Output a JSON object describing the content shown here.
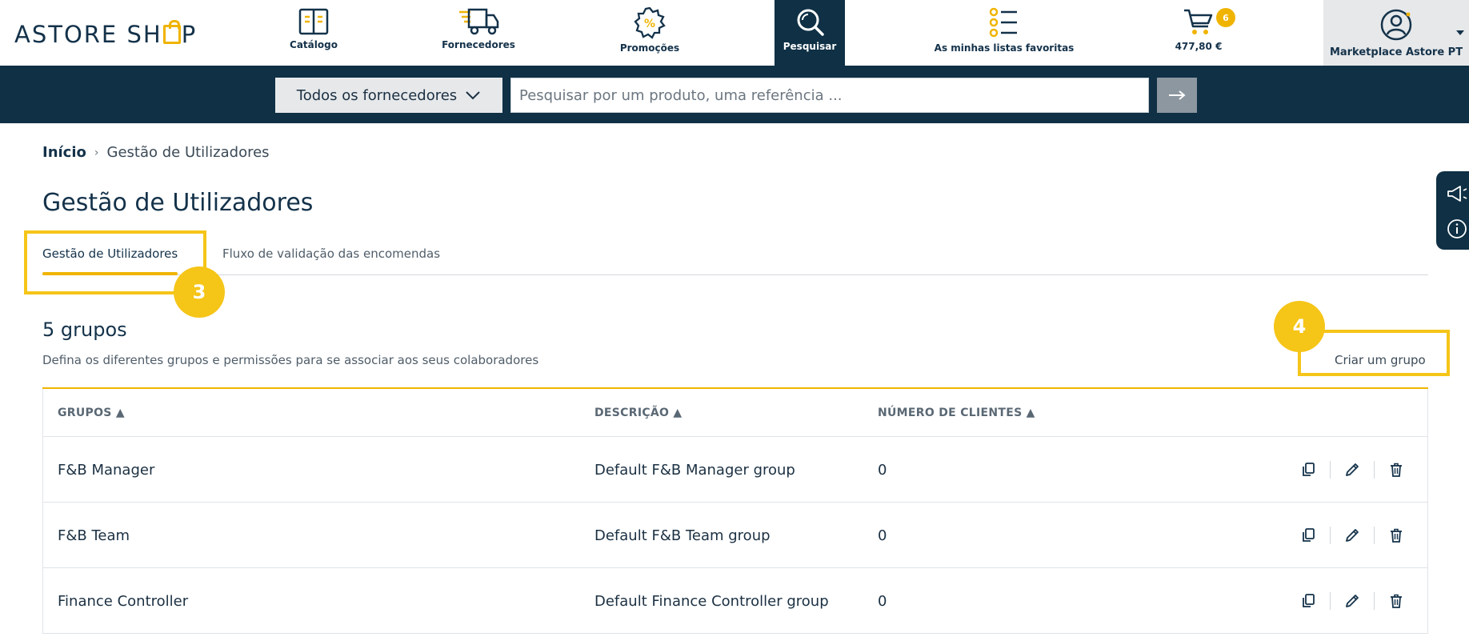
{
  "header": {
    "logo_text_a": "ASTORE SH",
    "logo_text_b": "P",
    "nav": [
      {
        "label": "Catálogo",
        "icon": "catalog-icon"
      },
      {
        "label": "Fornecedores",
        "icon": "truck-icon"
      },
      {
        "label": "Promoções",
        "icon": "promo-icon"
      },
      {
        "label": "Pesquisar",
        "icon": "search-icon"
      },
      {
        "label": "As minhas listas favoritas",
        "icon": "list-icon"
      },
      {
        "label": "477,80 €",
        "icon": "cart-icon",
        "badge": "6"
      }
    ],
    "account_label": "Marketplace Astore PT"
  },
  "search": {
    "supplier_select": "Todos os fornecedores",
    "placeholder": "Pesquisar por um produto, uma referência ..."
  },
  "breadcrumb": {
    "home": "Início",
    "current": "Gestão de Utilizadores"
  },
  "page": {
    "title": "Gestão de Utilizadores",
    "tabs": [
      {
        "label": "Gestão de Utilizadores",
        "active": true
      },
      {
        "label": "Fluxo de validação das encomendas",
        "active": false
      }
    ],
    "groups_title": "5 grupos",
    "groups_desc": "Defina os diferentes grupos e permissões para se associar aos seus colaboradores",
    "create_group": "Criar um grupo"
  },
  "annotations": {
    "step3": "3",
    "step4": "4"
  },
  "table": {
    "columns": [
      "GRUPOS ▲",
      "DESCRIÇÃO ▲",
      "NÚMERO DE CLIENTES ▲"
    ],
    "rows": [
      {
        "group": "F&B Manager",
        "description": "Default F&B Manager group",
        "clients": "0"
      },
      {
        "group": "F&B Team",
        "description": "Default F&B Team group",
        "clients": "0"
      },
      {
        "group": "Finance Controller",
        "description": "Default Finance Controller group",
        "clients": "0"
      }
    ]
  },
  "colors": {
    "navy": "#0f3045",
    "accent": "#f0b400",
    "highlight": "#f5c518"
  }
}
